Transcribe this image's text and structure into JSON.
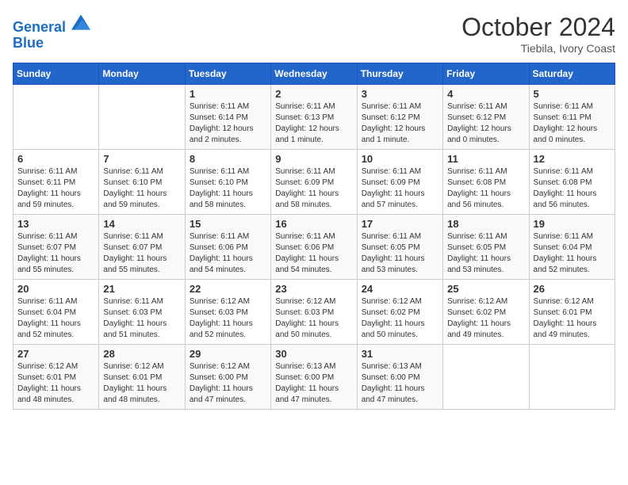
{
  "header": {
    "logo_line1": "General",
    "logo_line2": "Blue",
    "month_title": "October 2024",
    "location": "Tiebila, Ivory Coast"
  },
  "calendar": {
    "days_of_week": [
      "Sunday",
      "Monday",
      "Tuesday",
      "Wednesday",
      "Thursday",
      "Friday",
      "Saturday"
    ],
    "weeks": [
      [
        {
          "day": "",
          "info": ""
        },
        {
          "day": "",
          "info": ""
        },
        {
          "day": "1",
          "info": "Sunrise: 6:11 AM\nSunset: 6:14 PM\nDaylight: 12 hours\nand 2 minutes."
        },
        {
          "day": "2",
          "info": "Sunrise: 6:11 AM\nSunset: 6:13 PM\nDaylight: 12 hours\nand 1 minute."
        },
        {
          "day": "3",
          "info": "Sunrise: 6:11 AM\nSunset: 6:12 PM\nDaylight: 12 hours\nand 1 minute."
        },
        {
          "day": "4",
          "info": "Sunrise: 6:11 AM\nSunset: 6:12 PM\nDaylight: 12 hours\nand 0 minutes."
        },
        {
          "day": "5",
          "info": "Sunrise: 6:11 AM\nSunset: 6:11 PM\nDaylight: 12 hours\nand 0 minutes."
        }
      ],
      [
        {
          "day": "6",
          "info": "Sunrise: 6:11 AM\nSunset: 6:11 PM\nDaylight: 11 hours\nand 59 minutes."
        },
        {
          "day": "7",
          "info": "Sunrise: 6:11 AM\nSunset: 6:10 PM\nDaylight: 11 hours\nand 59 minutes."
        },
        {
          "day": "8",
          "info": "Sunrise: 6:11 AM\nSunset: 6:10 PM\nDaylight: 11 hours\nand 58 minutes."
        },
        {
          "day": "9",
          "info": "Sunrise: 6:11 AM\nSunset: 6:09 PM\nDaylight: 11 hours\nand 58 minutes."
        },
        {
          "day": "10",
          "info": "Sunrise: 6:11 AM\nSunset: 6:09 PM\nDaylight: 11 hours\nand 57 minutes."
        },
        {
          "day": "11",
          "info": "Sunrise: 6:11 AM\nSunset: 6:08 PM\nDaylight: 11 hours\nand 56 minutes."
        },
        {
          "day": "12",
          "info": "Sunrise: 6:11 AM\nSunset: 6:08 PM\nDaylight: 11 hours\nand 56 minutes."
        }
      ],
      [
        {
          "day": "13",
          "info": "Sunrise: 6:11 AM\nSunset: 6:07 PM\nDaylight: 11 hours\nand 55 minutes."
        },
        {
          "day": "14",
          "info": "Sunrise: 6:11 AM\nSunset: 6:07 PM\nDaylight: 11 hours\nand 55 minutes."
        },
        {
          "day": "15",
          "info": "Sunrise: 6:11 AM\nSunset: 6:06 PM\nDaylight: 11 hours\nand 54 minutes."
        },
        {
          "day": "16",
          "info": "Sunrise: 6:11 AM\nSunset: 6:06 PM\nDaylight: 11 hours\nand 54 minutes."
        },
        {
          "day": "17",
          "info": "Sunrise: 6:11 AM\nSunset: 6:05 PM\nDaylight: 11 hours\nand 53 minutes."
        },
        {
          "day": "18",
          "info": "Sunrise: 6:11 AM\nSunset: 6:05 PM\nDaylight: 11 hours\nand 53 minutes."
        },
        {
          "day": "19",
          "info": "Sunrise: 6:11 AM\nSunset: 6:04 PM\nDaylight: 11 hours\nand 52 minutes."
        }
      ],
      [
        {
          "day": "20",
          "info": "Sunrise: 6:11 AM\nSunset: 6:04 PM\nDaylight: 11 hours\nand 52 minutes."
        },
        {
          "day": "21",
          "info": "Sunrise: 6:11 AM\nSunset: 6:03 PM\nDaylight: 11 hours\nand 51 minutes."
        },
        {
          "day": "22",
          "info": "Sunrise: 6:12 AM\nSunset: 6:03 PM\nDaylight: 11 hours\nand 52 minutes."
        },
        {
          "day": "23",
          "info": "Sunrise: 6:12 AM\nSunset: 6:03 PM\nDaylight: 11 hours\nand 50 minutes."
        },
        {
          "day": "24",
          "info": "Sunrise: 6:12 AM\nSunset: 6:02 PM\nDaylight: 11 hours\nand 50 minutes."
        },
        {
          "day": "25",
          "info": "Sunrise: 6:12 AM\nSunset: 6:02 PM\nDaylight: 11 hours\nand 49 minutes."
        },
        {
          "day": "26",
          "info": "Sunrise: 6:12 AM\nSunset: 6:01 PM\nDaylight: 11 hours\nand 49 minutes."
        }
      ],
      [
        {
          "day": "27",
          "info": "Sunrise: 6:12 AM\nSunset: 6:01 PM\nDaylight: 11 hours\nand 48 minutes."
        },
        {
          "day": "28",
          "info": "Sunrise: 6:12 AM\nSunset: 6:01 PM\nDaylight: 11 hours\nand 48 minutes."
        },
        {
          "day": "29",
          "info": "Sunrise: 6:12 AM\nSunset: 6:00 PM\nDaylight: 11 hours\nand 47 minutes."
        },
        {
          "day": "30",
          "info": "Sunrise: 6:13 AM\nSunset: 6:00 PM\nDaylight: 11 hours\nand 47 minutes."
        },
        {
          "day": "31",
          "info": "Sunrise: 6:13 AM\nSunset: 6:00 PM\nDaylight: 11 hours\nand 47 minutes."
        },
        {
          "day": "",
          "info": ""
        },
        {
          "day": "",
          "info": ""
        }
      ]
    ]
  }
}
